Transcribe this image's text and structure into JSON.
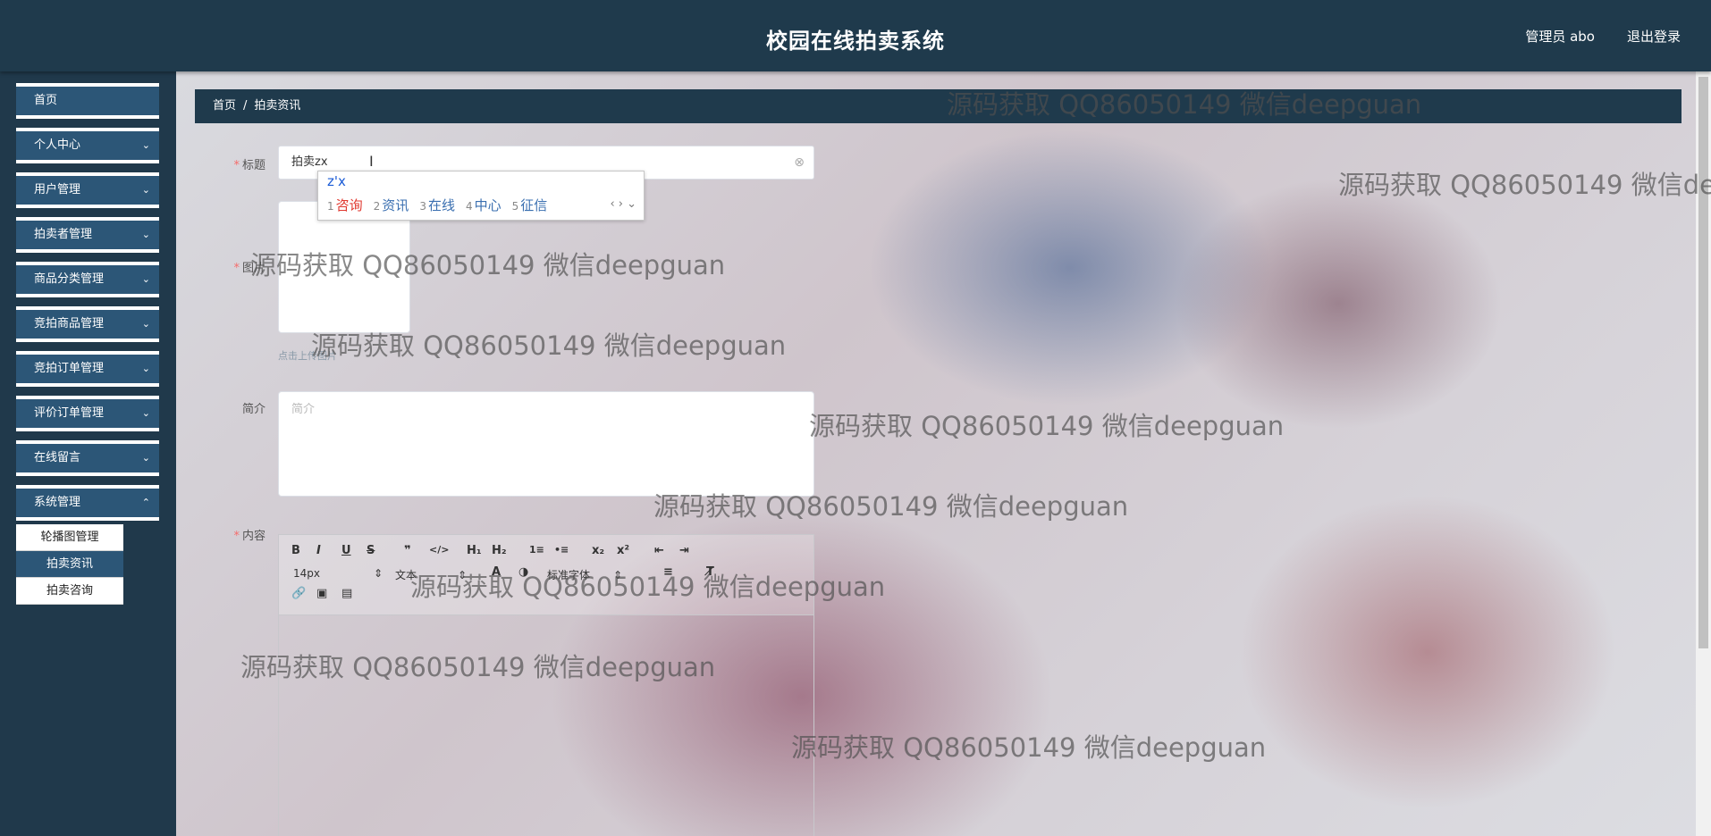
{
  "header": {
    "title": "校园在线拍卖系统",
    "user": "管理员 abo",
    "logout": "退出登录"
  },
  "sidebar": {
    "items": [
      {
        "label": "首页",
        "has_children": false
      },
      {
        "label": "个人中心",
        "has_children": true
      },
      {
        "label": "用户管理",
        "has_children": true
      },
      {
        "label": "拍卖者管理",
        "has_children": true
      },
      {
        "label": "商品分类管理",
        "has_children": true
      },
      {
        "label": "竞拍商品管理",
        "has_children": true
      },
      {
        "label": "竞拍订单管理",
        "has_children": true
      },
      {
        "label": "评价订单管理",
        "has_children": true
      },
      {
        "label": "在线留言",
        "has_children": true
      },
      {
        "label": "系统管理",
        "has_children": true
      }
    ],
    "submenu": [
      {
        "label": "轮播图管理",
        "active": false
      },
      {
        "label": "拍卖资讯",
        "active": true
      },
      {
        "label": "拍卖咨询",
        "active": false
      }
    ]
  },
  "breadcrumb": {
    "home": "首页",
    "sep": "/",
    "current": "拍卖资讯"
  },
  "form": {
    "title_label": "标题",
    "title_value": "拍卖zx",
    "image_label": "图片",
    "image_tip": "点击上传图片",
    "intro_label": "简介",
    "intro_placeholder": "简介",
    "content_label": "内容"
  },
  "ime": {
    "pinyin": "z'x",
    "candidates": [
      {
        "n": "1",
        "text": "咨询"
      },
      {
        "n": "2",
        "text": "资讯"
      },
      {
        "n": "3",
        "text": "在线"
      },
      {
        "n": "4",
        "text": "中心"
      },
      {
        "n": "5",
        "text": "征信"
      }
    ],
    "nav": "‹ › ⌄"
  },
  "editor": {
    "font_size": "14px",
    "text_type": "文本",
    "font_family": "标准字体",
    "buttons": {
      "bold": "B",
      "italic": "I",
      "underline": "U",
      "strike": "S",
      "quote": "❞",
      "code": "</>",
      "h1": "H₁",
      "h2": "H₂",
      "ol": "1≡",
      "ul": "•≡",
      "sub": "x₂",
      "sup": "x²",
      "outdent": "⇤",
      "indent": "⇥"
    }
  },
  "watermark": "源码获取 QQ86050149 微信deepguan",
  "colors": {
    "header": "#1f3a4c",
    "menu": "#2c5677",
    "required": "#f56c6c"
  }
}
